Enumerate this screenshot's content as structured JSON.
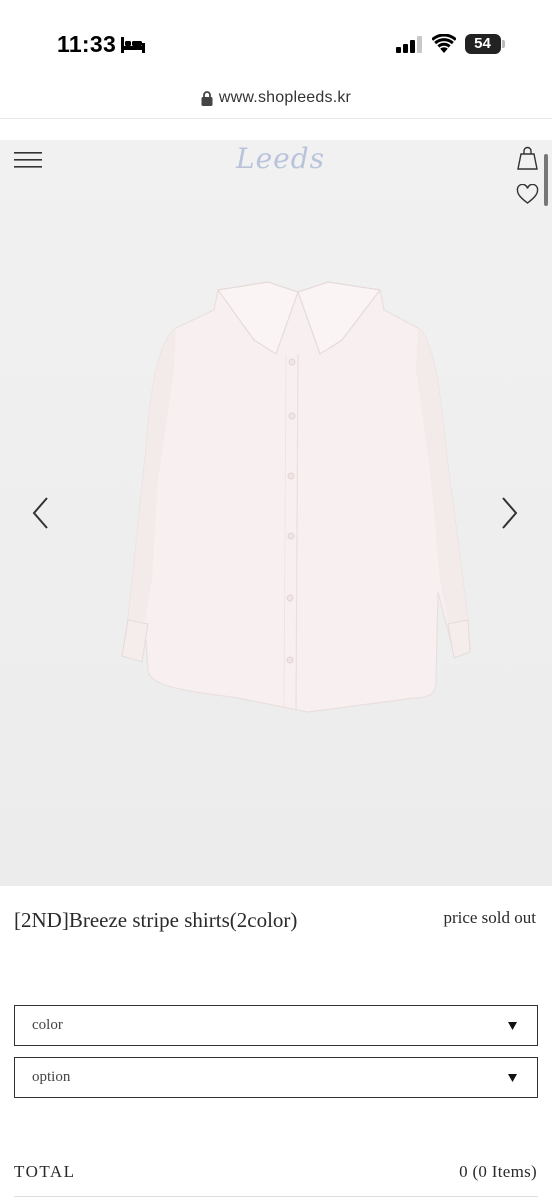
{
  "status_bar": {
    "time": "11:33",
    "battery_level": "54",
    "icons": [
      "bed-icon",
      "signal-icon",
      "wifi-icon",
      "battery-icon"
    ]
  },
  "browser": {
    "url": "www.shopleeds.kr",
    "icons": [
      "lock-icon"
    ]
  },
  "header": {
    "logo_text": "Leeds",
    "icons": [
      "menu-icon",
      "shopping-bag-icon",
      "heart-icon"
    ]
  },
  "gallery": {
    "image": "shirt-product-image",
    "icons": [
      "chevron-left-icon",
      "chevron-right-icon"
    ]
  },
  "product": {
    "title": "[2ND]Breeze stripe shirts(2color)",
    "price_status": "price sold out"
  },
  "options": {
    "color_label": "color",
    "option_label": "option"
  },
  "total": {
    "label": "TOTAL",
    "value": "0 (0 Items)"
  },
  "colors": {
    "logo": "#b9c4dc",
    "hero_bg": "#eeeeee",
    "shirt": "#f7eeee"
  }
}
